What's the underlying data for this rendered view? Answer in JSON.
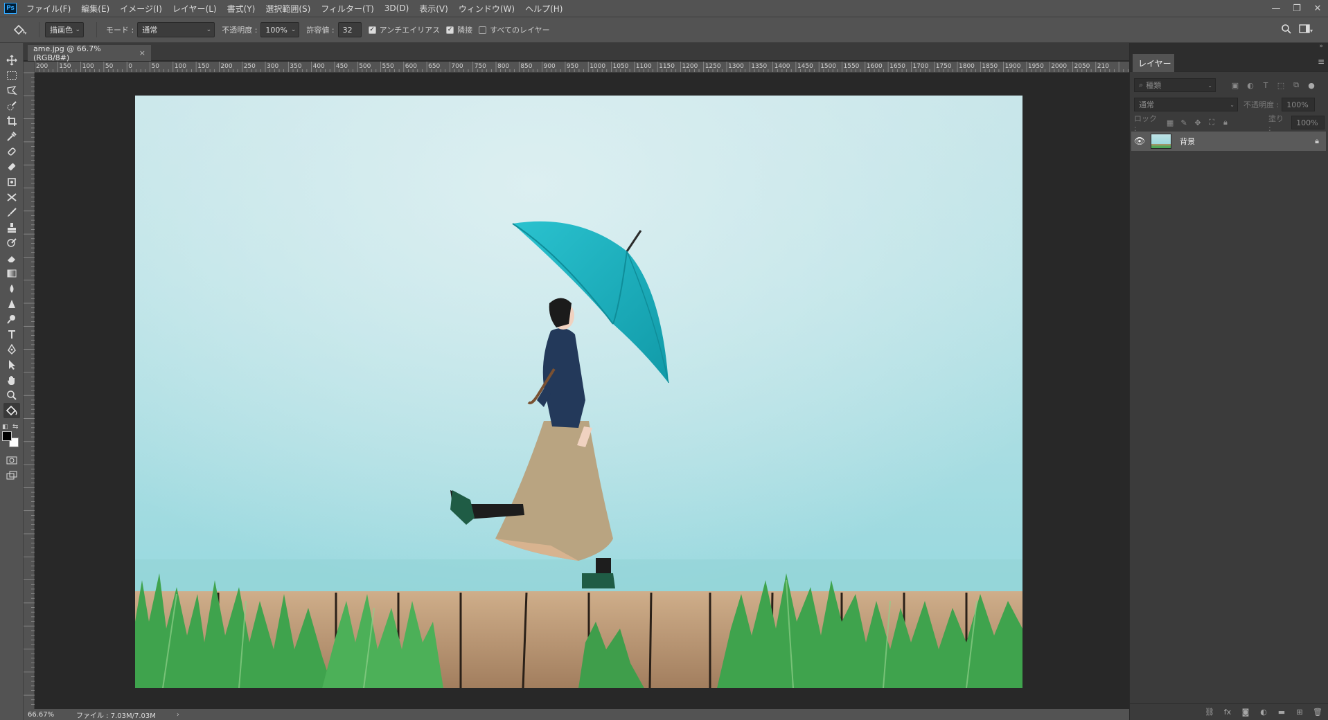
{
  "app": {
    "logo_text": "Ps",
    "menu": [
      "ファイル(F)",
      "編集(E)",
      "イメージ(I)",
      "レイヤー(L)",
      "書式(Y)",
      "選択範囲(S)",
      "フィルター(T)",
      "3D(D)",
      "表示(V)",
      "ウィンドウ(W)",
      "ヘルプ(H)"
    ],
    "window_controls": [
      "—",
      "❐",
      "✕"
    ]
  },
  "options": {
    "fill_source": "描画色",
    "mode_label": "モード :",
    "mode_value": "通常",
    "opacity_label": "不透明度 :",
    "opacity_value": "100%",
    "tolerance_label": "許容値 :",
    "tolerance_value": "32",
    "antialias_label": "アンチエイリアス",
    "contiguous_label": "隣接",
    "all_layers_label": "すべてのレイヤー",
    "antialias_checked": true,
    "contiguous_checked": true,
    "all_layers_checked": false
  },
  "document": {
    "tab_title": "ame.jpg @ 66.7% (RGB/8#)",
    "close": "×"
  },
  "rulers": {
    "h_labels": [
      "200",
      "150",
      "100",
      "50",
      "0",
      "50",
      "100",
      "150",
      "200",
      "250",
      "300",
      "350",
      "400",
      "450",
      "500",
      "550",
      "600",
      "650",
      "700",
      "750",
      "800",
      "850",
      "900",
      "950",
      "1000",
      "1050",
      "1100",
      "1150",
      "1200",
      "1250",
      "1300",
      "1350",
      "1400",
      "1450",
      "1500",
      "1550",
      "1600",
      "1650",
      "1700",
      "1750",
      "1800",
      "1850",
      "1900",
      "1950",
      "2000",
      "2050",
      "210"
    ]
  },
  "status": {
    "zoom": "66.67%",
    "file_info": "ファイル : 7.03M/7.03M",
    "arrow": "›"
  },
  "layers_panel": {
    "tab_label": "レイヤー",
    "filter_placeholder": "種類",
    "blend_mode": "通常",
    "opacity_label": "不透明度 :",
    "opacity_value": "100%",
    "lock_label": "ロック :",
    "fill_label": "塗り :",
    "fill_value": "100%",
    "layers": [
      {
        "name": "背景",
        "visible": true,
        "locked": true
      }
    ]
  },
  "colors": {
    "ui_bg": "#535353",
    "canvas_bg": "#282828",
    "umbrella": "#1fb5c2",
    "sky": "#a8dde2"
  }
}
